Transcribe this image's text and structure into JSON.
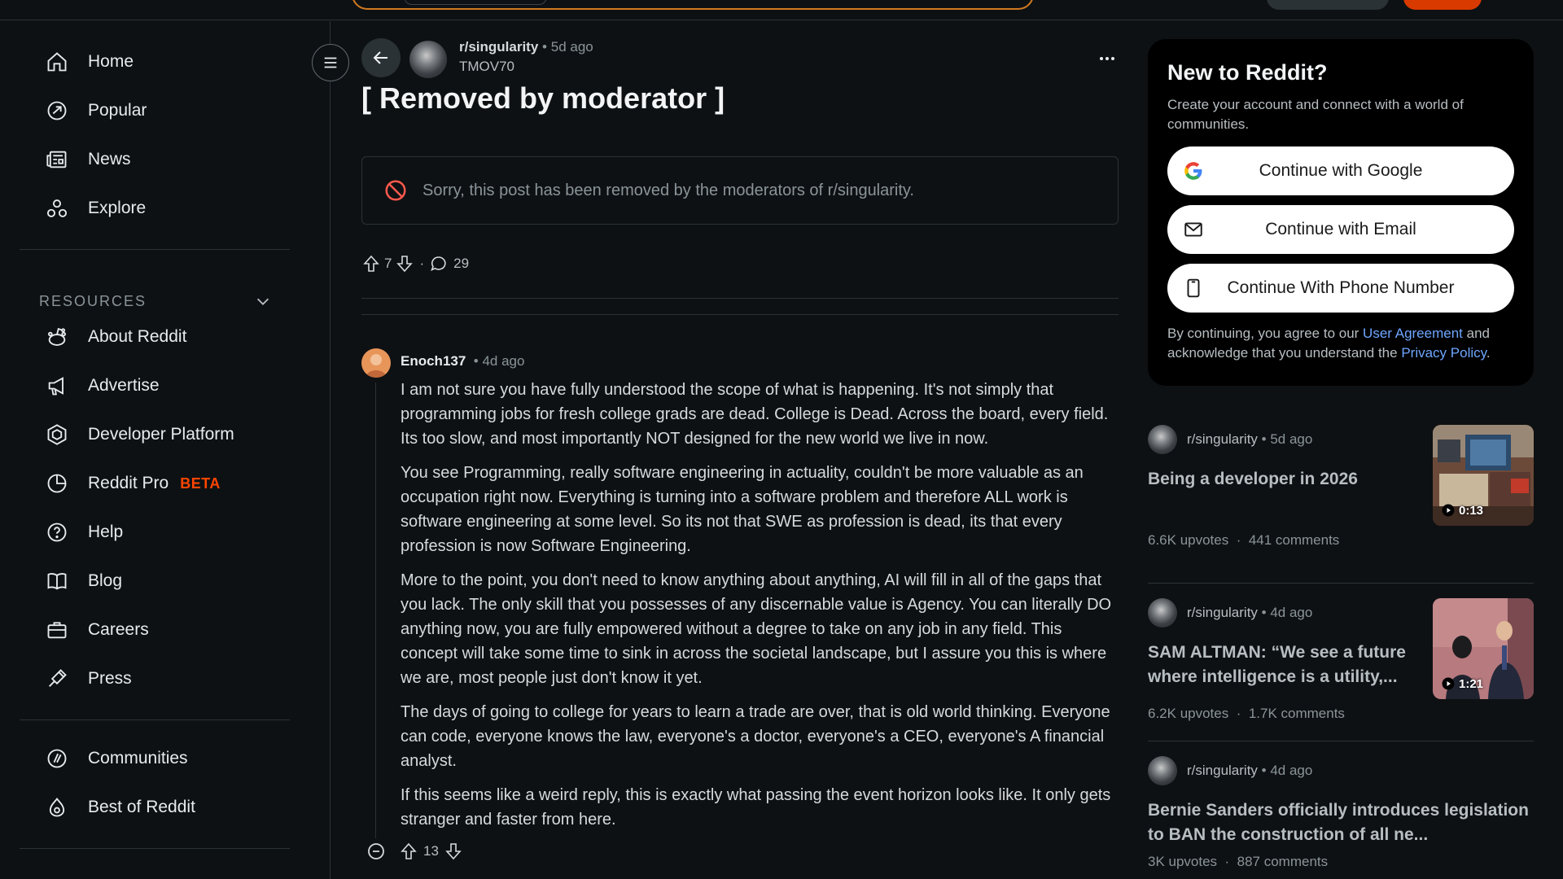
{
  "sidebar": {
    "nav": [
      {
        "label": "Home",
        "icon": "home-icon"
      },
      {
        "label": "Popular",
        "icon": "popular-icon"
      },
      {
        "label": "News",
        "icon": "news-icon"
      },
      {
        "label": "Explore",
        "icon": "explore-icon"
      }
    ],
    "resources_label": "RESOURCES",
    "resources": [
      {
        "label": "About Reddit",
        "icon": "reddit-alien-icon"
      },
      {
        "label": "Advertise",
        "icon": "megaphone-icon"
      },
      {
        "label": "Developer Platform",
        "icon": "developer-platform-icon"
      },
      {
        "label": "Reddit Pro",
        "icon": "reddit-pro-icon",
        "badge": "BETA"
      },
      {
        "label": "Help",
        "icon": "help-icon"
      },
      {
        "label": "Blog",
        "icon": "book-icon"
      },
      {
        "label": "Careers",
        "icon": "briefcase-icon"
      },
      {
        "label": "Press",
        "icon": "press-icon"
      }
    ],
    "bottom": [
      {
        "label": "Communities",
        "icon": "communities-icon"
      },
      {
        "label": "Best of Reddit",
        "icon": "best-of-reddit-icon"
      }
    ]
  },
  "post": {
    "subreddit": "r/singularity",
    "age": "5d ago",
    "author": "TMOV70",
    "title": "[ Removed by moderator ]",
    "removed_notice": "Sorry, this post has been removed by the moderators of r/singularity.",
    "upvotes": "7",
    "comments": "29"
  },
  "comment": {
    "author": "Enoch137",
    "age": "4d ago",
    "paragraphs": [
      "I am not sure you have fully understood the scope of what is happening. It's not simply that programming jobs for fresh college grads are dead. College is Dead. Across the board, every field. Its too slow, and most importantly NOT designed for the new world we live in now.",
      "You see Programming, really software engineering in actuality, couldn't be more valuable as an occupation right now. Everything is turning into a software problem and therefore ALL work is software engineering at some level. So its not that SWE as profession is dead, its that every profession is now Software Engineering.",
      "More to the point, you don't need to know anything about anything, AI will fill in all of the gaps that you lack. The only skill that you possesses of any discernable value is Agency. You can literally DO anything now, you are fully empowered without a degree to take on any job in any field. This concept will take some time to sink in across the societal landscape, but I assure you this is where we are, most people just don't know it yet.",
      "The days of going to college for years to learn a trade are over, that is old world thinking. Everyone can code, everyone knows the law, everyone's a doctor, everyone's a CEO, everyone's A financial analyst.",
      "If this seems like a weird reply, this is exactly what passing the event horizon looks like. It only gets stranger and faster from here."
    ],
    "upvotes": "13"
  },
  "auth": {
    "title": "New to Reddit?",
    "subtitle": "Create your account and connect with a world of communities.",
    "google": "Continue with Google",
    "email": "Continue with Email",
    "phone": "Continue With Phone Number",
    "legal_prefix": "By continuing, you agree to our ",
    "user_agreement": "User Agreement",
    "legal_middle": " and acknowledge that you understand the ",
    "privacy_policy": "Privacy Policy",
    "legal_suffix": "."
  },
  "recommended": [
    {
      "subreddit": "r/singularity",
      "age": "5d ago",
      "title": "Being a developer in 2026",
      "upvotes": "6.6K upvotes",
      "comments": "441 comments",
      "duration": "0:13"
    },
    {
      "subreddit": "r/singularity",
      "age": "4d ago",
      "title": "SAM ALTMAN: “We see a future where intelligence is a utility,...",
      "upvotes": "6.2K upvotes",
      "comments": "1.7K comments",
      "duration": "1:21"
    },
    {
      "subreddit": "r/singularity",
      "age": "4d ago",
      "title": "Bernie Sanders officially introduces legislation to BAN the construction of all ne...",
      "upvotes": "3K upvotes",
      "comments": "887 comments"
    }
  ],
  "colors": {
    "background": "#0e1113",
    "accent": "#ff4500",
    "link": "#6ea6ff",
    "search_outline": "#d17a1f"
  }
}
